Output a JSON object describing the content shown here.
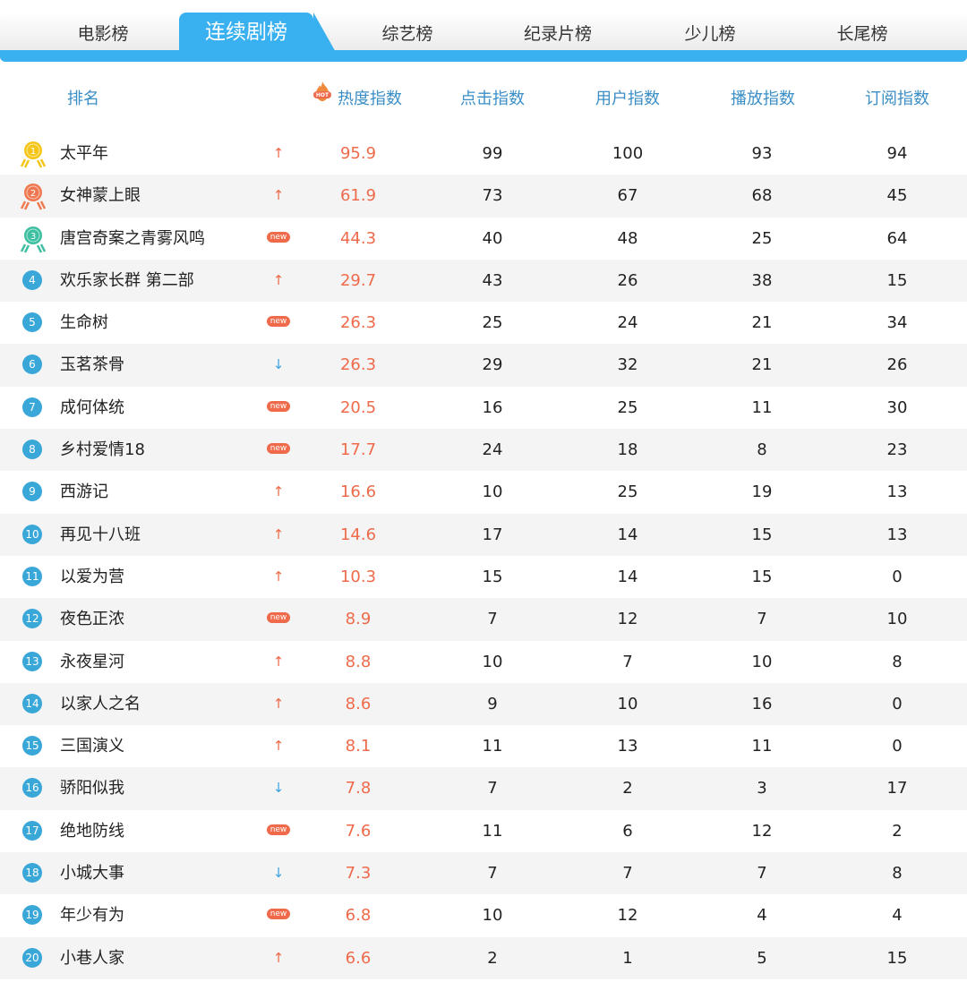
{
  "tabs": [
    {
      "label": "电影榜",
      "active": false
    },
    {
      "label": "连续剧榜",
      "active": true
    },
    {
      "label": "综艺榜",
      "active": false
    },
    {
      "label": "纪录片榜",
      "active": false
    },
    {
      "label": "少儿榜",
      "active": false
    },
    {
      "label": "长尾榜",
      "active": false
    }
  ],
  "header": {
    "rank": "排名",
    "heat": "热度指数",
    "hot_icon_text": "HOT",
    "click": "点击指数",
    "user": "用户指数",
    "play": "播放指数",
    "subscribe": "订阅指数"
  },
  "colors": {
    "accent": "#39b0ef",
    "heat": "#ef6a4a",
    "down": "#3aa3e3",
    "gold": "#f5c518",
    "silver": "#f07850",
    "bronze": "#3cbfa0"
  },
  "rows": [
    {
      "rank": "1",
      "name": "太平年",
      "trend": "up",
      "heat": "95.9",
      "click": "99",
      "user": "100",
      "play": "93",
      "subscribe": "94"
    },
    {
      "rank": "2",
      "name": "女神蒙上眼",
      "trend": "up",
      "heat": "61.9",
      "click": "73",
      "user": "67",
      "play": "68",
      "subscribe": "45"
    },
    {
      "rank": "3",
      "name": "唐宫奇案之青雾风鸣",
      "trend": "new",
      "heat": "44.3",
      "click": "40",
      "user": "48",
      "play": "25",
      "subscribe": "64"
    },
    {
      "rank": "4",
      "name": "欢乐家长群 第二部",
      "trend": "up",
      "heat": "29.7",
      "click": "43",
      "user": "26",
      "play": "38",
      "subscribe": "15"
    },
    {
      "rank": "5",
      "name": "生命树",
      "trend": "new",
      "heat": "26.3",
      "click": "25",
      "user": "24",
      "play": "21",
      "subscribe": "34"
    },
    {
      "rank": "6",
      "name": "玉茗茶骨",
      "trend": "down",
      "heat": "26.3",
      "click": "29",
      "user": "32",
      "play": "21",
      "subscribe": "26"
    },
    {
      "rank": "7",
      "name": "成何体统",
      "trend": "new",
      "heat": "20.5",
      "click": "16",
      "user": "25",
      "play": "11",
      "subscribe": "30"
    },
    {
      "rank": "8",
      "name": "乡村爱情18",
      "trend": "new",
      "heat": "17.7",
      "click": "24",
      "user": "18",
      "play": "8",
      "subscribe": "23"
    },
    {
      "rank": "9",
      "name": "西游记",
      "trend": "up",
      "heat": "16.6",
      "click": "10",
      "user": "25",
      "play": "19",
      "subscribe": "13"
    },
    {
      "rank": "10",
      "name": "再见十八班",
      "trend": "up",
      "heat": "14.6",
      "click": "17",
      "user": "14",
      "play": "15",
      "subscribe": "13"
    },
    {
      "rank": "11",
      "name": "以爱为营",
      "trend": "up",
      "heat": "10.3",
      "click": "15",
      "user": "14",
      "play": "15",
      "subscribe": "0"
    },
    {
      "rank": "12",
      "name": "夜色正浓",
      "trend": "new",
      "heat": "8.9",
      "click": "7",
      "user": "12",
      "play": "7",
      "subscribe": "10"
    },
    {
      "rank": "13",
      "name": "永夜星河",
      "trend": "up",
      "heat": "8.8",
      "click": "10",
      "user": "7",
      "play": "10",
      "subscribe": "8"
    },
    {
      "rank": "14",
      "name": "以家人之名",
      "trend": "up",
      "heat": "8.6",
      "click": "9",
      "user": "10",
      "play": "16",
      "subscribe": "0"
    },
    {
      "rank": "15",
      "name": "三国演义",
      "trend": "up",
      "heat": "8.1",
      "click": "11",
      "user": "13",
      "play": "11",
      "subscribe": "0"
    },
    {
      "rank": "16",
      "name": "骄阳似我",
      "trend": "down",
      "heat": "7.8",
      "click": "7",
      "user": "2",
      "play": "3",
      "subscribe": "17"
    },
    {
      "rank": "17",
      "name": "绝地防线",
      "trend": "new",
      "heat": "7.6",
      "click": "11",
      "user": "6",
      "play": "12",
      "subscribe": "2"
    },
    {
      "rank": "18",
      "name": "小城大事",
      "trend": "down",
      "heat": "7.3",
      "click": "7",
      "user": "7",
      "play": "7",
      "subscribe": "8"
    },
    {
      "rank": "19",
      "name": "年少有为",
      "trend": "new",
      "heat": "6.8",
      "click": "10",
      "user": "12",
      "play": "4",
      "subscribe": "4"
    },
    {
      "rank": "20",
      "name": "小巷人家",
      "trend": "up",
      "heat": "6.6",
      "click": "2",
      "user": "1",
      "play": "5",
      "subscribe": "15"
    }
  ],
  "trend_glyphs": {
    "up": "↑",
    "down": "↓",
    "new": "new"
  }
}
